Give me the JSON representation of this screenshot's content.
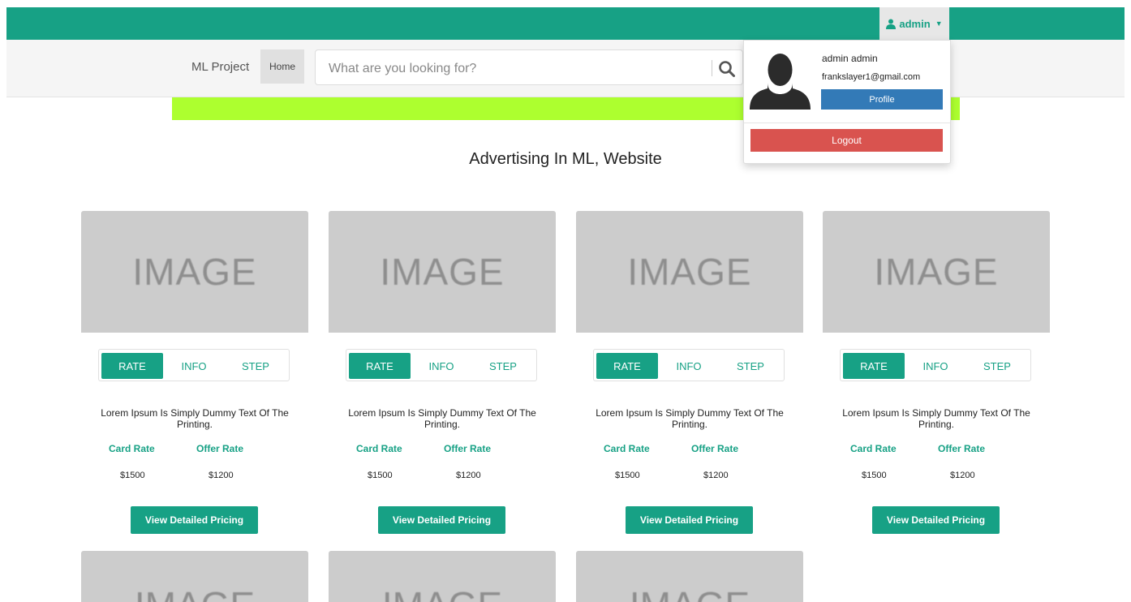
{
  "topbar": {
    "user_label": "admin",
    "user_icon": "user-icon",
    "caret_icon": "caret-down-icon",
    "accent_color": "#17a185"
  },
  "navbar": {
    "brand": "ML Project",
    "home_label": "Home",
    "search_placeholder": "What are you looking for?",
    "search_icon": "search-icon"
  },
  "banner": {
    "color": "#adff2f"
  },
  "heading": "Advertising In ML, Website",
  "cards": [
    {
      "image_text": "IMAGE",
      "tabs": [
        "RATE",
        "INFO",
        "STEP"
      ],
      "active_tab": "RATE",
      "description": "Lorem Ipsum Is Simply Dummy Text Of The Printing.",
      "card_rate_label": "Card Rate",
      "offer_rate_label": "Offer Rate",
      "card_rate": "$1500",
      "offer_rate": "$1200",
      "button_label": "View Detailed Pricing"
    },
    {
      "image_text": "IMAGE",
      "tabs": [
        "RATE",
        "INFO",
        "STEP"
      ],
      "active_tab": "RATE",
      "description": "Lorem Ipsum Is Simply Dummy Text Of The Printing.",
      "card_rate_label": "Card Rate",
      "offer_rate_label": "Offer Rate",
      "card_rate": "$1500",
      "offer_rate": "$1200",
      "button_label": "View Detailed Pricing"
    },
    {
      "image_text": "IMAGE",
      "tabs": [
        "RATE",
        "INFO",
        "STEP"
      ],
      "active_tab": "RATE",
      "description": "Lorem Ipsum Is Simply Dummy Text Of The Printing.",
      "card_rate_label": "Card Rate",
      "offer_rate_label": "Offer Rate",
      "card_rate": "$1500",
      "offer_rate": "$1200",
      "button_label": "View Detailed Pricing"
    },
    {
      "image_text": "IMAGE",
      "tabs": [
        "RATE",
        "INFO",
        "STEP"
      ],
      "active_tab": "RATE",
      "description": "Lorem Ipsum Is Simply Dummy Text Of The Printing.",
      "card_rate_label": "Card Rate",
      "offer_rate_label": "Offer Rate",
      "card_rate": "$1500",
      "offer_rate": "$1200",
      "button_label": "View Detailed Pricing"
    }
  ],
  "partial_cards": [
    {
      "image_text": "IMAGE"
    },
    {
      "image_text": "IMAGE"
    },
    {
      "image_text": "IMAGE"
    }
  ],
  "dropdown": {
    "name": "admin admin",
    "email": "frankslayer1@gmail.com",
    "profile_label": "Profile",
    "logout_label": "Logout",
    "avatar_icon": "user-silhouette-icon",
    "profile_color": "#337ab7",
    "logout_color": "#d9534f"
  }
}
